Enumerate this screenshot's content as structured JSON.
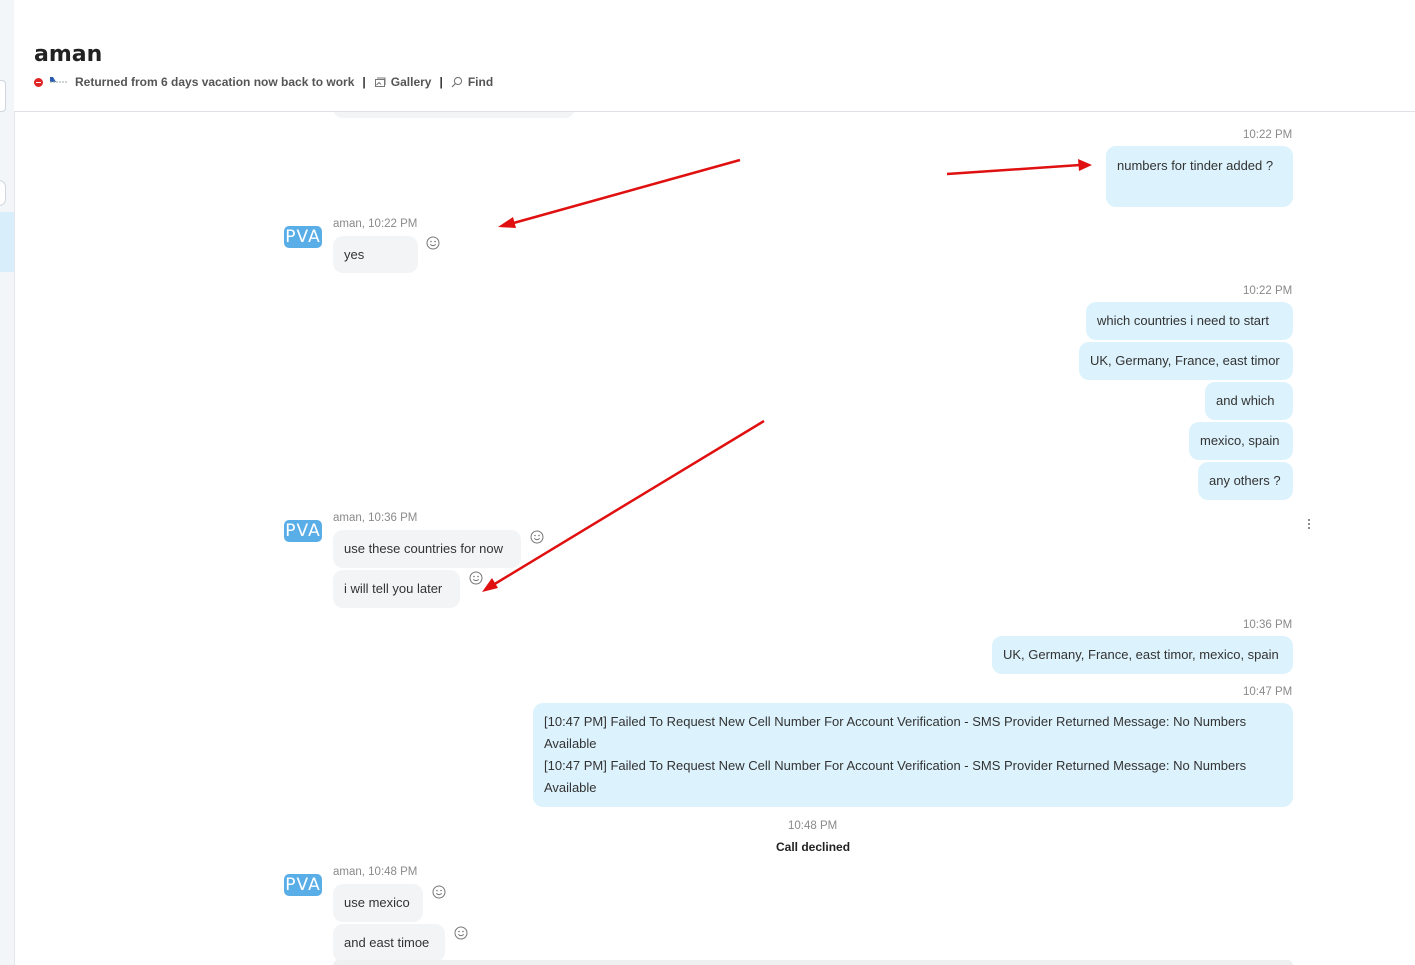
{
  "contact": {
    "name": "aman",
    "mood": "Returned from 6 days vacation now back to work",
    "gallery_label": "Gallery",
    "find_label": "Find",
    "separator": "|",
    "avatar_text": "PVA"
  },
  "messages": {
    "m1_time": "10:22 PM",
    "m1_text": "numbers for tinder added ?",
    "m2_meta": "aman, 10:22 PM",
    "m2_text": "yes",
    "m3_time": "10:22 PM",
    "m3_texts": [
      "which countries i need to start",
      "UK, Germany, France, east timor",
      "and which",
      "mexico, spain",
      "any others ?"
    ],
    "m4_meta": "aman, 10:36 PM",
    "m4_texts": [
      "use these countries for now",
      "i will tell you later"
    ],
    "m5_time": "10:36 PM",
    "m5_text": "UK, Germany, France, east timor, mexico, spain",
    "m6_time": "10:47 PM",
    "m6_lines": [
      "[10:47 PM] Failed To Request New Cell Number For Account Verification - SMS Provider Returned Message: No Numbers Available",
      "[10:47 PM] Failed To Request New Cell Number For Account Verification - SMS Provider Returned Message: No Numbers Available"
    ],
    "call_time": "10:48 PM",
    "call_text": "Call declined",
    "m7_meta": "aman, 10:48 PM",
    "m7_texts": [
      "use mexico",
      "and east timoe"
    ]
  },
  "colors": {
    "incoming_bubble": "#f2f4f6",
    "outgoing_bubble": "#dcf2fc",
    "avatar": "#5aaee8",
    "annotation_arrow": "#e01010",
    "busy_status": "#e02424"
  }
}
